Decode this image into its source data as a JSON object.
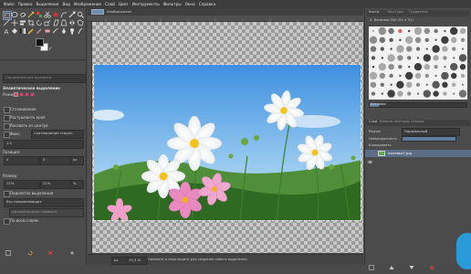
{
  "menu": {
    "items": [
      "Файл",
      "Правка",
      "Выделение",
      "Вид",
      "Изображение",
      "Слой",
      "Цвет",
      "Инструменты",
      "Фильтры",
      "Окна",
      "Справка"
    ]
  },
  "toolbox": {
    "search_placeholder": "Параметры инструмента",
    "title": "Эллиптическое выделение",
    "mode_label": "Режим:",
    "antialias_label": "Сглаживание",
    "feather_label": "Растушевать края",
    "expand_center_label": "Рисовать из центра",
    "fixed_label": "Фикс.",
    "fixed_value": "Соотношение сторон",
    "ratio_value": "1:1",
    "position_label": "Позиция:",
    "position_unit": "px",
    "pos_x": "0",
    "pos_y": "0",
    "size_label": "Размер:",
    "size_unit": "%",
    "size_w": "11%",
    "size_h": "21%",
    "highlight_label": "Подсветка выделения",
    "guides_value": "Без направляющих",
    "autoshrink_label": "Автоматически сжимать",
    "shrink_merged_label": "По всем слоям"
  },
  "image_tab": {
    "title": "Изображение"
  },
  "status": {
    "unit": "px",
    "zoom": "33,3 %",
    "message": "Нажмите и перетащите для создания нового выделения"
  },
  "dock": {
    "tabs": [
      "Кисти",
      "Текстуры",
      "Градиенты"
    ],
    "brush_name": "2. Hardness 050 (51 × 51)",
    "spacing_label": "Интервал",
    "layers_tabs": [
      "Слои",
      "Каналы",
      "Контуры",
      "Отмена"
    ],
    "mode_label": "Режим",
    "mode_value": "Нормальный",
    "opacity_label": "Непрозрачность",
    "lock_label": "Блокировать:",
    "layer_name": "полевка7.jpg"
  },
  "colors": {
    "fg": "#111111",
    "bg": "#ffffff",
    "accent": "#2a9bd8",
    "selected_layer": "#5c6f86"
  }
}
